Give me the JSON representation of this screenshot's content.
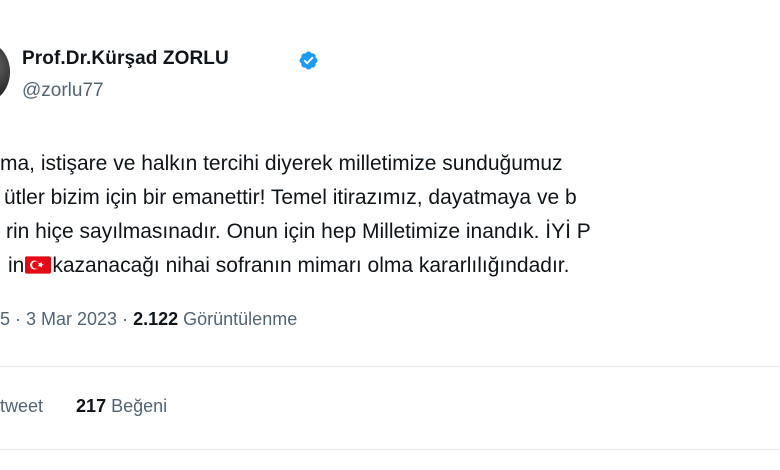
{
  "author": {
    "name": "Prof.Dr.Kürşad ZORLU",
    "handle": "@zorlu77",
    "verified_icon": "verified-badge-icon",
    "verified_color": "#1d9bf0"
  },
  "tweet": {
    "lines": [
      "ma, istişare ve halkın tercihi diyerek milletimize sunduğumuz",
      "ütler bizim için bir emanettir! Temel itirazımız, dayatmaya ve b",
      "rin hiçe sayılmasınadır. Onun için hep Milletimize inandık. İYİ P"
    ],
    "line4_before_flag": "in",
    "line4_flag_icon": "turkey-flag-icon",
    "line4_after_flag": "kazanacağı nihai sofranın mimarı olma kararlılığındadır."
  },
  "meta": {
    "time_date": "5 · 3 Mar 2023 ·",
    "views_count": "2.122",
    "views_label": "Görüntülenme"
  },
  "stats": {
    "retweet_label": "tweet",
    "likes_count": "217",
    "likes_label": "Beğeni"
  },
  "colors": {
    "text_primary": "#0f1419",
    "text_secondary": "#536471",
    "divider": "#e3e7ea",
    "flag_red": "#e30a17"
  }
}
